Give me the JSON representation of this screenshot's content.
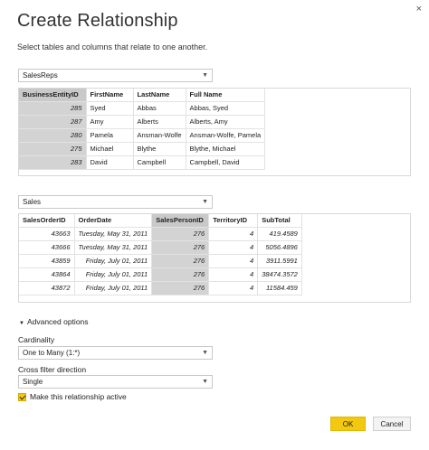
{
  "dialog": {
    "close_glyph": "×",
    "title": "Create Relationship",
    "subtitle": "Select tables and columns that relate to one another."
  },
  "table1": {
    "selected": "SalesReps",
    "columns": [
      "BusinessEntityID",
      "FirstName",
      "LastName",
      "Full Name"
    ],
    "selected_column": "BusinessEntityID",
    "rows": [
      [
        "285",
        "Syed",
        "Abbas",
        "Abbas, Syed"
      ],
      [
        "287",
        "Amy",
        "Alberts",
        "Alberts, Amy"
      ],
      [
        "280",
        "Pamela",
        "Ansman-Wolfe",
        "Ansman-Wolfe, Pamela"
      ],
      [
        "275",
        "Michael",
        "Blythe",
        "Blythe, Michael"
      ],
      [
        "283",
        "David",
        "Campbell",
        "Campbell, David"
      ]
    ]
  },
  "table2": {
    "selected": "Sales",
    "columns": [
      "SalesOrderID",
      "OrderDate",
      "SalesPersonID",
      "TerritoryID",
      "SubTotal"
    ],
    "selected_column": "SalesPersonID",
    "rows": [
      [
        "43663",
        "Tuesday, May 31, 2011",
        "276",
        "4",
        "419.4589"
      ],
      [
        "43666",
        "Tuesday, May 31, 2011",
        "276",
        "4",
        "5056.4896"
      ],
      [
        "43859",
        "Friday, July 01, 2011",
        "276",
        "4",
        "3911.5991"
      ],
      [
        "43864",
        "Friday, July 01, 2011",
        "276",
        "4",
        "38474.3572"
      ],
      [
        "43872",
        "Friday, July 01, 2011",
        "276",
        "4",
        "11584.459"
      ]
    ]
  },
  "advanced": {
    "toggle_label": "Advanced options",
    "cardinality_label": "Cardinality",
    "cardinality_value": "One to Many (1:*)",
    "cross_filter_label": "Cross filter direction",
    "cross_filter_value": "Single",
    "active_label": "Make this relationship active",
    "active_checked": true
  },
  "buttons": {
    "ok": "OK",
    "cancel": "Cancel"
  },
  "colors": {
    "accent": "#f2c811",
    "selected_column": "#d3d3d3"
  }
}
